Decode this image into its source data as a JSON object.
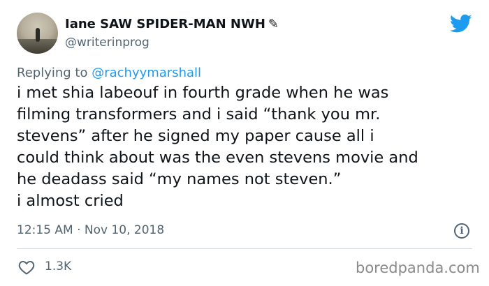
{
  "author": {
    "display_name": "Iane SAW SPIDER-MAN NWH",
    "name_emoji": "✎",
    "handle": "@writerinprog"
  },
  "reply": {
    "prefix": "Replying to ",
    "to_handle": "@rachyymarshall"
  },
  "tweet": {
    "text": "i met shia labeouf in fourth grade when he was\nfilming transformers and i said “thank you mr.\nstevens” after he signed my paper cause all i\ncould think about was the even stevens movie and\nhe deadass said “my names not steven.”\ni almost cried",
    "timestamp": "12:15 AM · Nov 10, 2018",
    "likes": "1.3K"
  },
  "icons": {
    "brand": "twitter-bird-icon",
    "info": "info-icon",
    "like": "heart-icon"
  },
  "colors": {
    "brand_blue": "#1d9bf0",
    "secondary_text": "#536471",
    "divider": "#cfd9de"
  },
  "watermark": "boredpanda.com"
}
